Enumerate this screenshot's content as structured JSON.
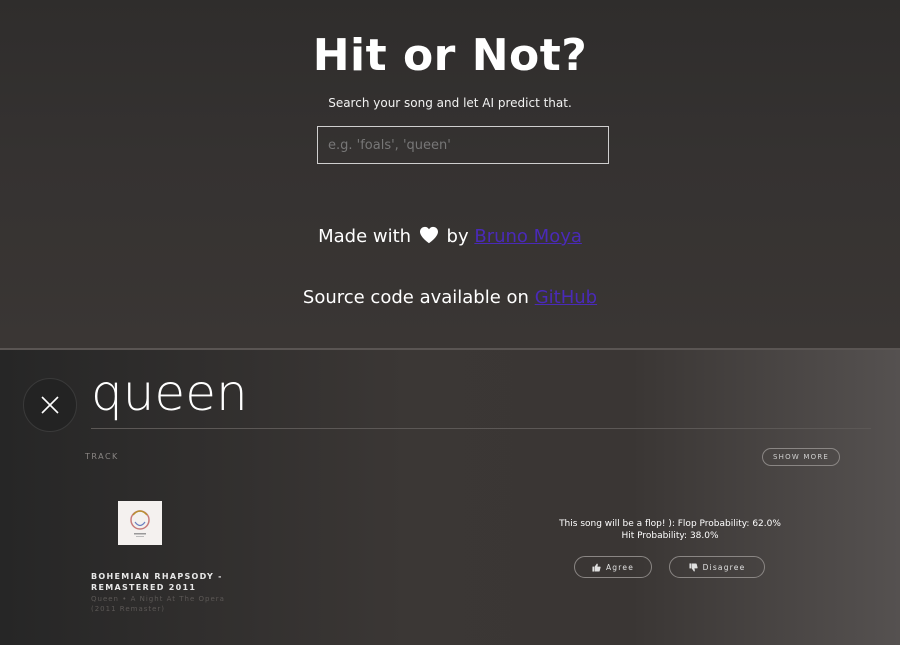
{
  "header": {
    "title": "Hit or Not?",
    "subtitle": "Search your song and let AI predict that.",
    "search_placeholder": "e.g. 'foals', 'queen'"
  },
  "credits": {
    "made_with_prefix": "Made with",
    "made_with_by": "by",
    "author_link": "Bruno Moya",
    "source_prefix": "Source code available on",
    "source_link": "GitHub"
  },
  "results": {
    "query": "queen",
    "section_label": "TRACK",
    "show_more_label": "SHOW MORE",
    "track": {
      "name": "BOHEMIAN RHAPSODY - REMASTERED 2011",
      "artist": "Queen • A Night At The Opera (2011 Remaster)",
      "prediction_line1": "This song will be a flop! ): Flop Probability: 62.0%",
      "prediction_line2": "Hit Probability: 38.0%",
      "agree_label": "Agree",
      "disagree_label": "Disagree"
    }
  },
  "icons": {
    "close": "close-icon",
    "heart": "heart-icon",
    "thumbs_up": "thumbs-up-icon",
    "thumbs_down": "thumbs-down-icon"
  },
  "colors": {
    "link": "#4a2ab8",
    "background": "#2e2c2b",
    "text": "#ffffff"
  }
}
